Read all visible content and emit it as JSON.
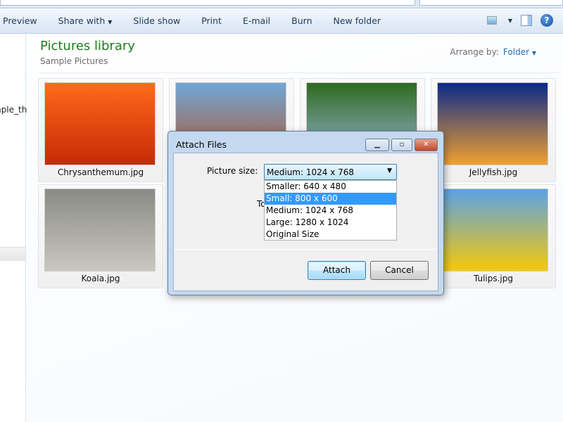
{
  "toolbar": {
    "items": [
      "Preview",
      "Share with",
      "Slide show",
      "Print",
      "E-mail",
      "Burn",
      "New folder"
    ],
    "help": "?"
  },
  "nav": {
    "partial_item": "mple_th"
  },
  "library": {
    "title": "Pictures library",
    "subtitle": "Sample Pictures",
    "arrange_label": "Arrange by:",
    "arrange_value": "Folder"
  },
  "tiles": [
    {
      "caption": "Chrysanthemum.jpg",
      "colors": [
        "#ff6a1a",
        "#c62a06"
      ]
    },
    {
      "caption": "",
      "colors": [
        "#6fa7d6",
        "#b4542a"
      ]
    },
    {
      "caption": "",
      "colors": [
        "#2e6b1f",
        "#9fb7de"
      ]
    },
    {
      "caption": "Jellyfish.jpg",
      "colors": [
        "#0a2a8a",
        "#f0a030"
      ]
    },
    {
      "caption": "Koala.jpg",
      "colors": [
        "#8a8a86",
        "#c9c7c0"
      ]
    },
    {
      "caption": "Tulips.jpg",
      "colors": [
        "#5aa2e6",
        "#f5c80a"
      ]
    }
  ],
  "dialog": {
    "title": "Attach Files",
    "picture_size_label": "Picture size:",
    "partial_text": "To",
    "selected": "Medium: 1024 x 768",
    "options": [
      "Smaller: 640 x 480",
      "Small: 800 x 600",
      "Medium: 1024 x 768",
      "Large: 1280 x 1024",
      "Original Size"
    ],
    "highlighted_option": "Small: 800 x 600",
    "attach": "Attach",
    "cancel": "Cancel"
  }
}
